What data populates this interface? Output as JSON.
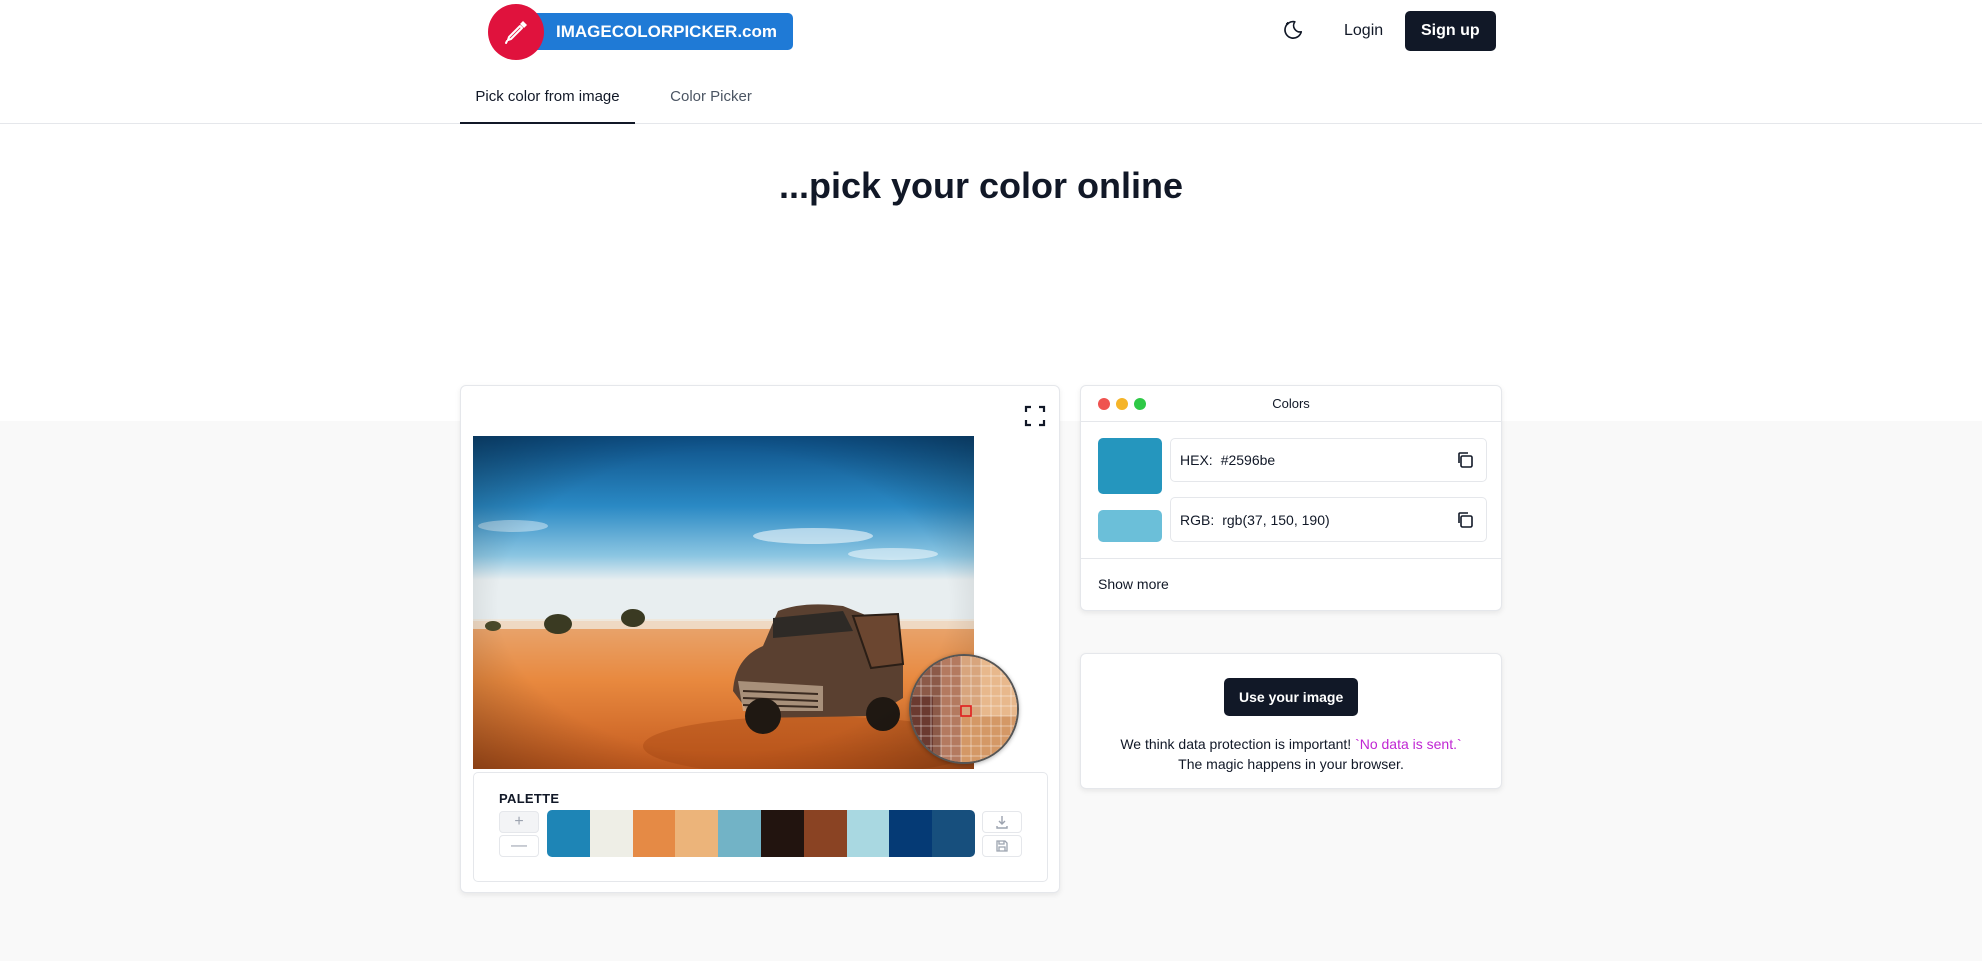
{
  "header": {
    "logo_text": "IMAGECOLORPICKER.com",
    "login_label": "Login",
    "signup_label": "Sign up"
  },
  "tabs": [
    {
      "label": "Pick color from image",
      "active": true
    },
    {
      "label": "Color Picker",
      "active": false
    }
  ],
  "hero": {
    "title": "...pick your color online"
  },
  "palette": {
    "label": "PALETTE",
    "add_symbol": "+",
    "remove_symbol": "—",
    "swatches": [
      "#1e85b6",
      "#eeeee6",
      "#e58a45",
      "#ecb47a",
      "#72b3c6",
      "#22140f",
      "#8a4323",
      "#a9d8e1",
      "#053a75",
      "#174f7d"
    ]
  },
  "colors_panel": {
    "title": "Colors",
    "hex_label": "HEX:",
    "hex_value": "#2596be",
    "rgb_label": "RGB:",
    "rgb_value": "rgb(37, 150, 190)",
    "hex_swatch_color": "#2596be",
    "rgb_swatch_color": "#6bbfd9",
    "show_more_label": "Show more"
  },
  "upload": {
    "button_label": "Use your image",
    "privacy_text": "We think data protection is important!",
    "privacy_highlight": "`No data is sent.`",
    "privacy_text_2": "The magic happens in your browser."
  },
  "colors": {
    "brand_blue": "#1f7ad6",
    "brand_red": "#e0123d",
    "dark": "#111827",
    "highlight": "#c026d3"
  }
}
